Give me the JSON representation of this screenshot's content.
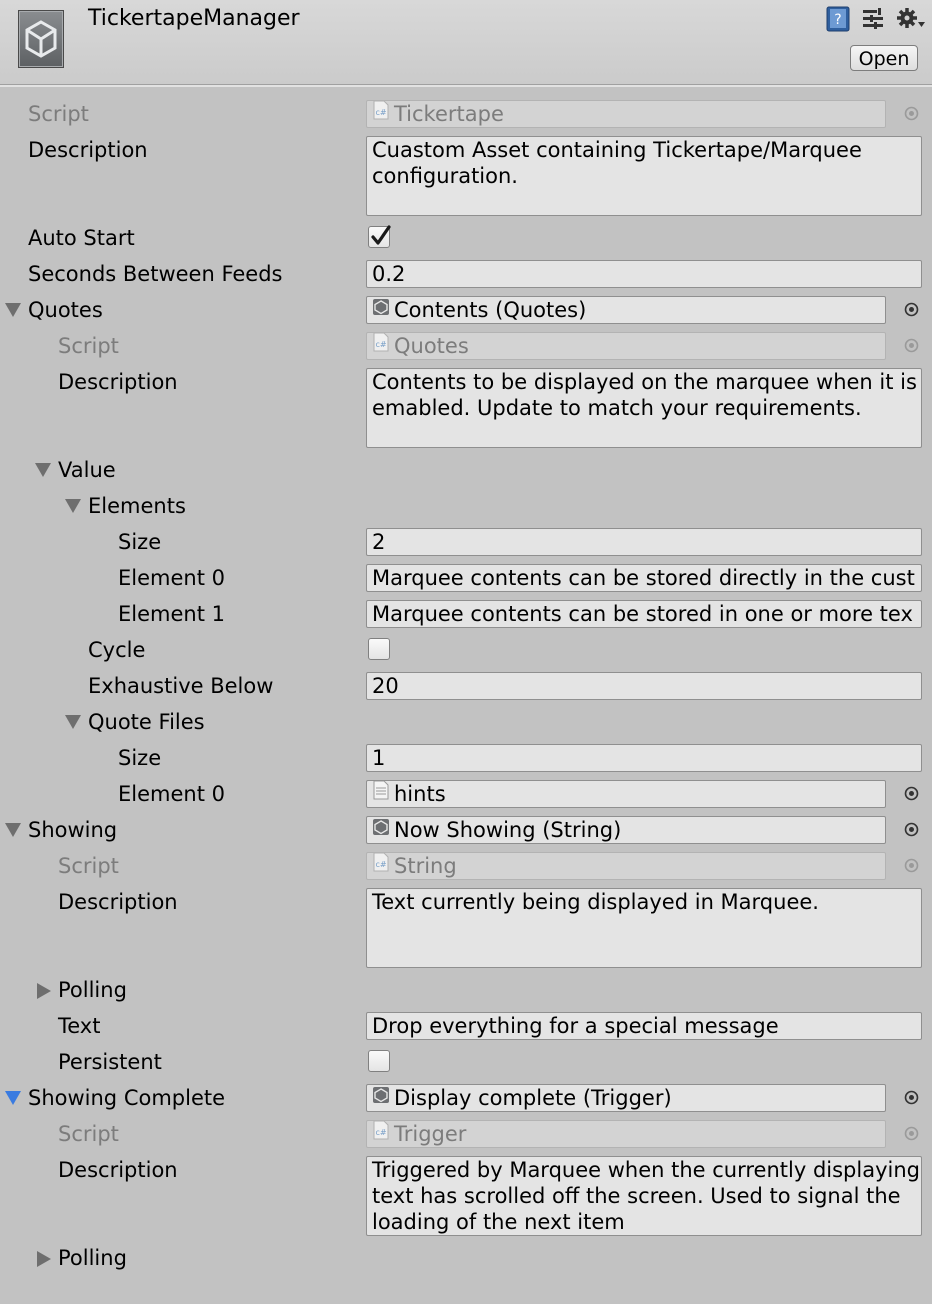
{
  "header": {
    "title": "TickertapeManager",
    "open_label": "Open"
  },
  "rows": {
    "script": {
      "label": "Script",
      "value": "Tickertape"
    },
    "description": {
      "label": "Description",
      "value": "Cuastom Asset containing Tickertape/Marquee configuration."
    },
    "auto_start": {
      "label": "Auto Start",
      "checked": true
    },
    "seconds_between_feeds": {
      "label": "Seconds Between Feeds",
      "value": "0.2"
    },
    "quotes": {
      "label": "Quotes",
      "value": "Contents (Quotes)"
    },
    "quotes_script": {
      "label": "Script",
      "value": "Quotes"
    },
    "quotes_description": {
      "label": "Description",
      "value": "Contents to be displayed on the marquee when it is emabled. Update to match your requirements."
    },
    "value": {
      "label": "Value"
    },
    "elements": {
      "label": "Elements"
    },
    "elements_size": {
      "label": "Size",
      "value": "2"
    },
    "element_0": {
      "label": "Element 0",
      "value": "Marquee contents can be stored directly in the cust"
    },
    "element_1": {
      "label": "Element 1",
      "value": "Marquee contents can be stored in one or more tex"
    },
    "cycle": {
      "label": "Cycle",
      "checked": false
    },
    "exhaustive_below": {
      "label": "Exhaustive Below",
      "value": "20"
    },
    "quote_files": {
      "label": "Quote Files"
    },
    "quote_files_size": {
      "label": "Size",
      "value": "1"
    },
    "quote_files_element_0": {
      "label": "Element 0",
      "value": "hints"
    },
    "showing": {
      "label": "Showing",
      "value": "Now Showing (String)"
    },
    "showing_script": {
      "label": "Script",
      "value": "String"
    },
    "showing_description": {
      "label": "Description",
      "value": "Text currently being displayed in Marquee."
    },
    "polling": {
      "label": "Polling"
    },
    "text": {
      "label": "Text",
      "value": "Drop everything for a special message"
    },
    "persistent": {
      "label": "Persistent",
      "checked": false
    },
    "showing_complete": {
      "label": "Showing Complete",
      "value": "Display complete (Trigger)"
    },
    "complete_script": {
      "label": "Script",
      "value": "Trigger"
    },
    "complete_description": {
      "label": "Description",
      "value": "Triggered by Marquee when the currently displaying text has scrolled off the screen. Used to signal the loading of the next item"
    },
    "polling_2": {
      "label": "Polling"
    }
  },
  "icons": {
    "logo": "unity-logo-icon",
    "help": "help-book-icon",
    "preset": "preset-sliders-icon",
    "settings": "gear-icon",
    "script": "cs-script-icon",
    "scriptable_object": "scriptable-object-icon",
    "text_asset": "text-file-icon",
    "picker": "object-picker-icon"
  },
  "colors": {
    "background": "#c2c2c2",
    "field": "#e4e4e4",
    "disabled_text": "#7c7c7c",
    "foldout_blue": "#3a7be0"
  }
}
